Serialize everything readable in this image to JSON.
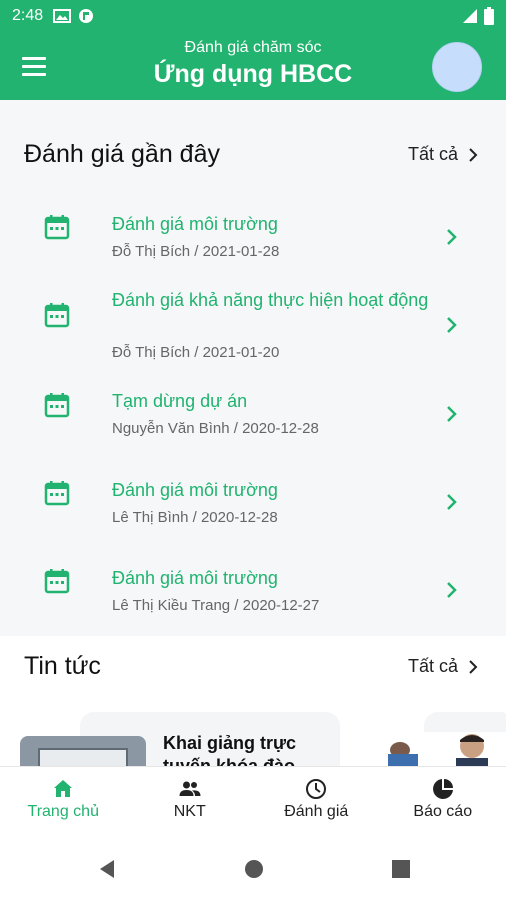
{
  "status_bar": {
    "time": "2:48"
  },
  "app_bar": {
    "subtitle": "Đánh giá chăm sóc",
    "title": "Ứng dụng HBCC"
  },
  "recent": {
    "title": "Đánh giá gần đây",
    "see_all": "Tất cả",
    "items": [
      {
        "title": "Đánh giá môi trường",
        "meta": "Đỗ Thị Bích / 2021-01-28"
      },
      {
        "title": "Đánh giá khả năng thực hiện hoạt động",
        "meta": "Đỗ Thị Bích / 2021-01-20"
      },
      {
        "title": "Tạm dừng dự án",
        "meta": "Nguyễn Văn Bình / 2020-12-28"
      },
      {
        "title": "Đánh giá môi trường",
        "meta": "Lê Thị Bình / 2020-12-28"
      },
      {
        "title": "Đánh giá môi trường",
        "meta": "Lê Thị Kiều Trang / 2020-12-27"
      }
    ]
  },
  "news": {
    "title": "Tin tức",
    "see_all": "Tất cả",
    "items": [
      {
        "title": "Khai giảng trực tuyến khóa đào"
      }
    ]
  },
  "bottom_nav": {
    "tabs": [
      {
        "label": "Trang chủ",
        "icon": "home-icon",
        "active": true
      },
      {
        "label": "NKT",
        "icon": "people-icon",
        "active": false
      },
      {
        "label": "Đánh giá",
        "icon": "clock-icon",
        "active": false
      },
      {
        "label": "Báo cáo",
        "icon": "pie-chart-icon",
        "active": false
      }
    ]
  },
  "colors": {
    "primary": "#21b36f",
    "avatar": "#c6ddfb"
  }
}
